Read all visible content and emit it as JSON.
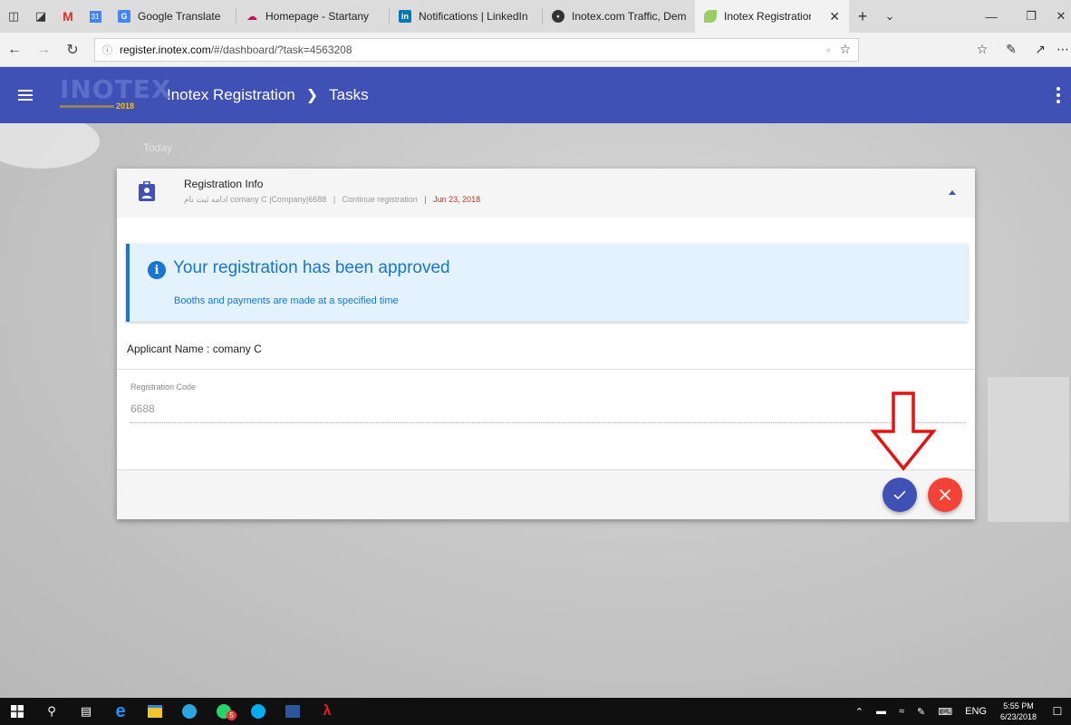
{
  "browser": {
    "tabs": [
      {
        "title": "Google Translate",
        "favicon": "google-translate-icon",
        "color": "#4285f4"
      },
      {
        "title": "Homepage - Startany",
        "favicon": "cloud-icon",
        "color": "#c2185b"
      },
      {
        "title": "Notifications | LinkedIn",
        "favicon": "linkedin-icon",
        "color": "#0077b5"
      },
      {
        "title": "Inotex.com Traffic, Demogr",
        "favicon": "globe-icon",
        "color": "#333333"
      },
      {
        "title": "Inotex Registration",
        "favicon": "leaf-icon",
        "color": "#9ccc65",
        "active": true
      }
    ],
    "new_tab": "+",
    "url_host": "register.inotex.com",
    "url_path": "/#/dashboard/?task=4563208"
  },
  "header": {
    "logo_text": "INOTEX",
    "logo_year": "2018",
    "breadcrumb_root": "Inotex Registration",
    "breadcrumb_current": "Tasks",
    "color": "#3f51b5"
  },
  "page": {
    "today_label": "Today"
  },
  "card": {
    "title": "Registration Info",
    "subtitle_parts": {
      "task": "ادامه ثبت نام",
      "company": "comany C |Company|6688",
      "action": "Continue registration",
      "date": "Jun 23, 2018"
    },
    "alert": {
      "title": "Your registration has been approved",
      "text": "Booths and payments are made at a specified time",
      "color": "#1976d2"
    },
    "applicant": "Applicant Name : comany C",
    "field": {
      "label": "Registration Code",
      "value": "6688"
    },
    "actions": {
      "approve_icon": "check-icon",
      "reject_icon": "close-icon",
      "approve_color": "#3f51b5",
      "reject_color": "#f44336"
    }
  },
  "taskbar": {
    "lang": "ENG",
    "time": "5:55 PM",
    "date": "6/23/2018",
    "telegram_badge": "5"
  }
}
